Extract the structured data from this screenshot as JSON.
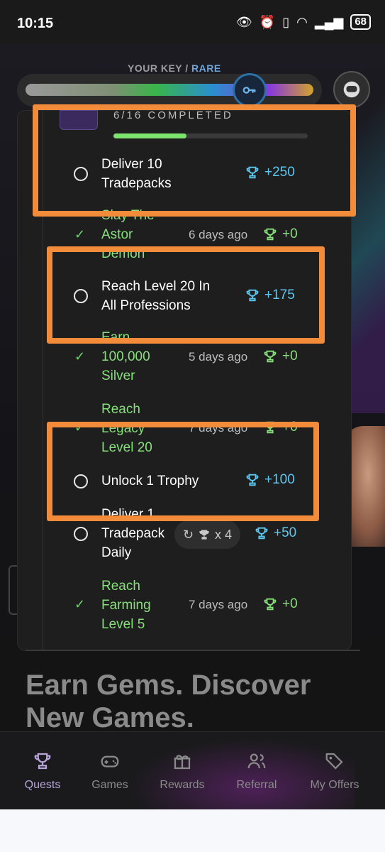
{
  "status_bar": {
    "time": "10:15",
    "battery": "68"
  },
  "key": {
    "label": "YOUR KEY",
    "separator": " / ",
    "rarity": "RARE",
    "rarity_color": "#6fa4d8"
  },
  "achievements_header": {
    "progress_text": "6/16 COMPLETED",
    "progress_fraction": 0.375
  },
  "quests": [
    {
      "title_lines": [
        "Deliver 10",
        "Tradepacks"
      ],
      "status": "open",
      "reward": "+250"
    },
    {
      "title_lines": [
        "Slay The",
        "Astor",
        "Demon"
      ],
      "status": "done",
      "ago": "6 days ago",
      "reward": "+0"
    },
    {
      "title_lines": [
        "Reach Level 20 In",
        "All Professions"
      ],
      "status": "open",
      "reward": "+175"
    },
    {
      "title_lines": [
        "Earn",
        "100,000",
        "Silver"
      ],
      "status": "done",
      "ago": "5 days ago",
      "reward": "+0"
    },
    {
      "title_lines": [
        "Reach",
        "Legacy",
        "Level 20"
      ],
      "status": "done",
      "ago": "7 days ago",
      "reward": "+0"
    },
    {
      "title_lines": [
        "Unlock 1 Trophy"
      ],
      "status": "open",
      "reward": "+100"
    },
    {
      "title_lines": [
        "Deliver 1",
        "Tradepack",
        "Daily"
      ],
      "status": "open",
      "reward": "+50",
      "repeat": "x 4"
    },
    {
      "title_lines": [
        "Reach",
        "Farming",
        "Level 5"
      ],
      "status": "done",
      "ago": "7 days ago",
      "reward": "+0"
    }
  ],
  "headline": {
    "line1": "Earn Gems. Discover",
    "line2": "New Games."
  },
  "nav": [
    {
      "label": "Quests",
      "icon": "trophy-icon",
      "active": true
    },
    {
      "label": "Games",
      "icon": "gamepad-icon"
    },
    {
      "label": "Rewards",
      "icon": "gift-icon"
    },
    {
      "label": "Referral",
      "icon": "users-icon"
    },
    {
      "label": "My Offers",
      "icon": "tags-icon"
    }
  ],
  "colors": {
    "accent_green": "#86e07a",
    "accent_blue": "#5cc8f0",
    "highlight": "#f28c3a",
    "active_nav": "#b6a3d8"
  }
}
